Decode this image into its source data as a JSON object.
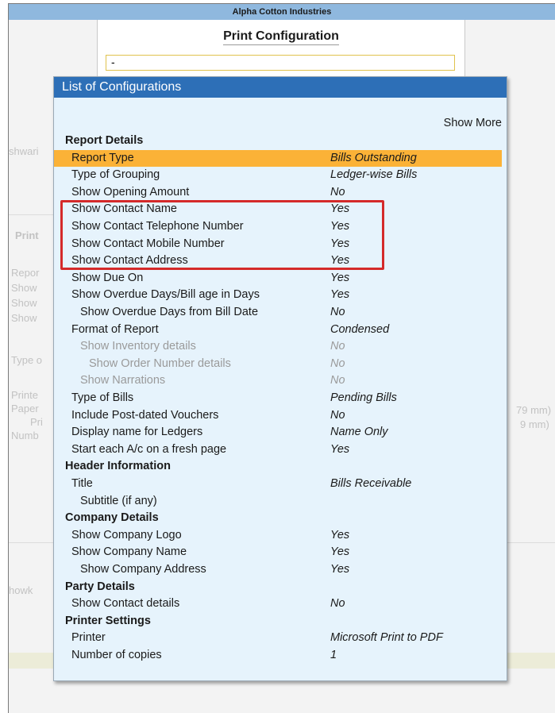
{
  "window": {
    "title": "Alpha Cotton Industries"
  },
  "background": {
    "left_labels": [
      "shwari",
      "Print",
      "Repor",
      "Show",
      "Show",
      "Show",
      "Type o",
      "Printe",
      "Paper",
      "Pri",
      "Numb",
      "howk"
    ],
    "right_labels": [
      "79 mm)",
      "9 mm)"
    ]
  },
  "print_configuration": {
    "title": "Print Configuration",
    "input_value": "-"
  },
  "list": {
    "title": "List of Configurations",
    "show_more": "Show More",
    "rows": [
      {
        "label": "Report Details",
        "value": "",
        "type": "section"
      },
      {
        "label": "Report Type",
        "value": "Bills Outstanding",
        "type": "l1",
        "selected": true
      },
      {
        "label": "Type of Grouping",
        "value": "Ledger-wise Bills",
        "type": "l1"
      },
      {
        "label": "Show Opening Amount",
        "value": "No",
        "type": "l1"
      },
      {
        "label": "Show Contact Name",
        "value": "Yes",
        "type": "l1"
      },
      {
        "label": "Show Contact Telephone Number",
        "value": "Yes",
        "type": "l1"
      },
      {
        "label": "Show Contact Mobile Number",
        "value": "Yes",
        "type": "l1"
      },
      {
        "label": "Show Contact Address",
        "value": "Yes",
        "type": "l1"
      },
      {
        "label": "Show Due On",
        "value": "Yes",
        "type": "l1"
      },
      {
        "label": "Show Overdue Days/Bill age in Days",
        "value": "Yes",
        "type": "l1"
      },
      {
        "label": "Show Overdue Days from Bill Date",
        "value": "No",
        "type": "l2"
      },
      {
        "label": "Format of Report",
        "value": "Condensed",
        "type": "l1"
      },
      {
        "label": "Show Inventory details",
        "value": "No",
        "type": "l2",
        "muted": true
      },
      {
        "label": "Show Order Number details",
        "value": "No",
        "type": "l3",
        "muted": true
      },
      {
        "label": "Show Narrations",
        "value": "No",
        "type": "l2",
        "muted": true
      },
      {
        "label": "Type of Bills",
        "value": "Pending Bills",
        "type": "l1"
      },
      {
        "label": "Include Post-dated Vouchers",
        "value": "No",
        "type": "l1"
      },
      {
        "label": "Display name for Ledgers",
        "value": "Name Only",
        "type": "l1"
      },
      {
        "label": "Start each A/c on a fresh page",
        "value": "Yes",
        "type": "l1"
      },
      {
        "label": "Header Information",
        "value": "",
        "type": "section"
      },
      {
        "label": "Title",
        "value": "Bills Receivable",
        "type": "l1"
      },
      {
        "label": "Subtitle (if any)",
        "value": "",
        "type": "l2"
      },
      {
        "label": "Company Details",
        "value": "",
        "type": "section"
      },
      {
        "label": "Show Company Logo",
        "value": "Yes",
        "type": "l1"
      },
      {
        "label": "Show Company Name",
        "value": "Yes",
        "type": "l1"
      },
      {
        "label": "Show Company Address",
        "value": "Yes",
        "type": "l2"
      },
      {
        "label": "Party Details",
        "value": "",
        "type": "section"
      },
      {
        "label": "Show Contact details",
        "value": "No",
        "type": "l1"
      },
      {
        "label": "Printer Settings",
        "value": "",
        "type": "section"
      },
      {
        "label": "Printer",
        "value": "Microsoft Print to PDF",
        "type": "l1"
      },
      {
        "label": "Number of copies",
        "value": "1",
        "type": "l1"
      }
    ]
  },
  "colors": {
    "header_bar": "#2d6fb7",
    "selected_row": "#fbb237",
    "highlight_box": "#d42a2a",
    "panel_bg": "#e6f3fc"
  }
}
